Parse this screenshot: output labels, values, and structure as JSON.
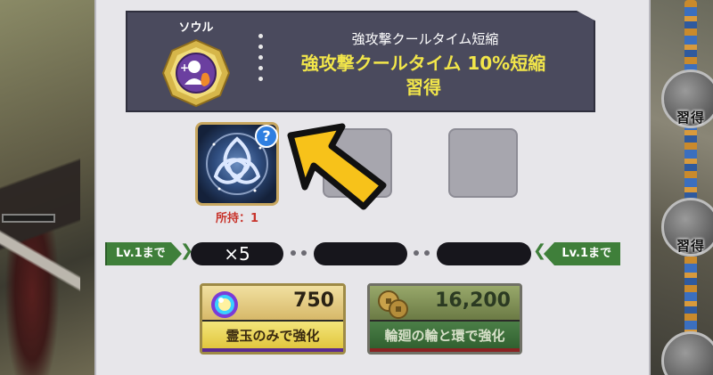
{
  "soul_card": {
    "label": "ソウル",
    "skill_name": "強攻撃クールタイム短縮",
    "skill_effect": "強攻撃クールタイム 10%短縮",
    "skill_status": "習得"
  },
  "material": {
    "help_symbol": "?",
    "owned_text": "所持：1"
  },
  "level_bar": {
    "left_tag": "Lv.1まで",
    "right_tag": "Lv.1まで",
    "quantity": "×5"
  },
  "buttons": {
    "gem_cost": "750",
    "gem_label": "霊玉のみで強化",
    "coin_cost": "16,200",
    "coin_label": "輪廻の輪と環で強化"
  },
  "right_panel": {
    "node_label_1": "習得",
    "node_label_2": "習得"
  },
  "icons": {
    "soul": "soul-badge-icon",
    "material": "triquetra-emblem-icon",
    "help": "question-mark-icon",
    "arrow": "pointer-arrow-icon",
    "gem": "rainbow-orb-icon",
    "coin": "coins-icon"
  },
  "colors": {
    "accent_yellow": "#f2e64a",
    "owned_red": "#c8342c",
    "level_green": "#3f7f3a"
  }
}
